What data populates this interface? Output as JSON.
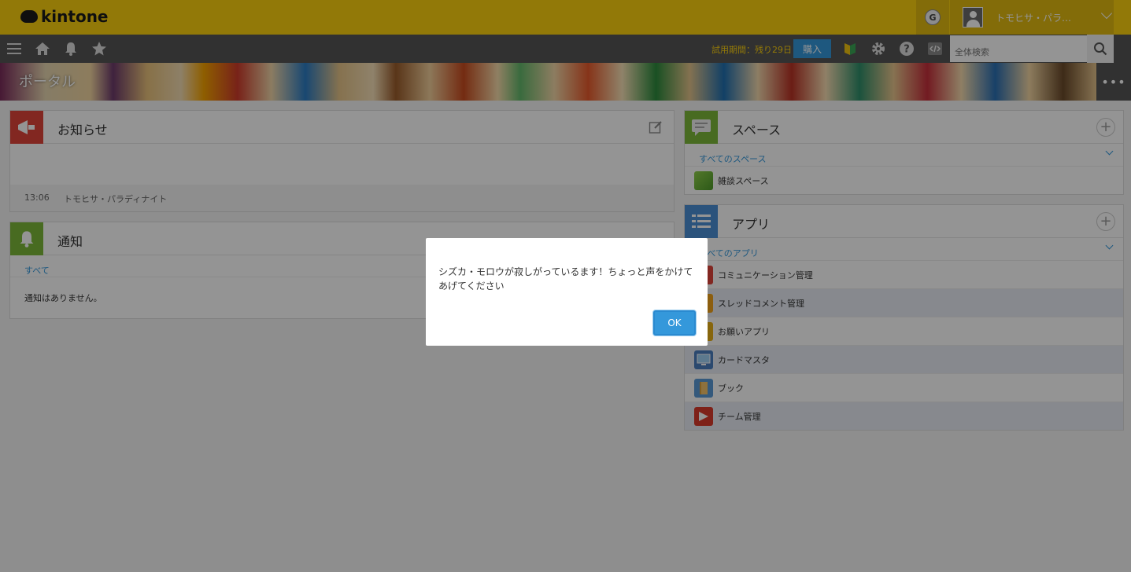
{
  "header": {
    "logo_text": "kintone",
    "g_label": "G",
    "user_name": "トモヒサ・パラ…"
  },
  "navbar": {
    "trial_text": "試用期間：残り29日",
    "buy_label": "購入",
    "search_placeholder": "全体検索"
  },
  "banner": {
    "title": "ポータル",
    "more_label": "•••"
  },
  "announcements": {
    "title": "お知らせ",
    "time": "13:06",
    "author": "トモヒサ・パラディナイト"
  },
  "notifications": {
    "title": "通知",
    "filter_label": "すべて",
    "empty_text": "通知はありません。"
  },
  "spaces": {
    "title": "スペース",
    "filter_label": "すべてのスペース",
    "items": [
      {
        "label": "雑談スペース"
      }
    ]
  },
  "apps": {
    "title": "アプリ",
    "filter_label": "すべてのアプリ",
    "items": [
      {
        "label": "コミュニケーション管理",
        "color": "#e0443a"
      },
      {
        "label": "スレッドコメント管理",
        "color": "#f2a31a"
      },
      {
        "label": "お願いアプリ",
        "color": "#e8b018"
      },
      {
        "label": "カードマスタ",
        "color": "#4b7fbf"
      },
      {
        "label": "ブック",
        "color": "#5a9ad6"
      },
      {
        "label": "チーム管理",
        "color": "#d93a2b"
      }
    ]
  },
  "dialog": {
    "message": "シズカ・モロウが寂しがっているます！ちょっと声をかけてあげてください",
    "ok_label": "OK"
  },
  "colors": {
    "header_yellow": "#fcd00f",
    "nav_gray": "#555555",
    "accent_blue": "#3498db"
  }
}
